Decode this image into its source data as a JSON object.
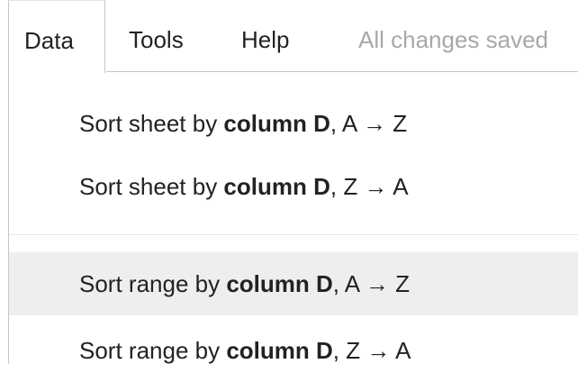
{
  "menubar": {
    "items": [
      {
        "label": "Data",
        "open": true
      },
      {
        "label": "Tools"
      },
      {
        "label": "Help"
      }
    ],
    "save_status": "All changes saved"
  },
  "data_menu": {
    "items": [
      {
        "prefix": "Sort sheet by ",
        "column": "column D",
        "order": ", A → Z"
      },
      {
        "prefix": "Sort sheet by ",
        "column": "column D",
        "order": ", Z → A"
      },
      {
        "prefix": "Sort range by ",
        "column": "column D",
        "order": ", A → Z",
        "highlighted": true
      },
      {
        "prefix": "Sort range by ",
        "column": "column D",
        "order": ", Z → A"
      }
    ]
  },
  "colors": {
    "text": "#222222",
    "status_text": "#a8a8a8",
    "hover_bg": "#eeeeee",
    "border": "#c6c6c6"
  }
}
